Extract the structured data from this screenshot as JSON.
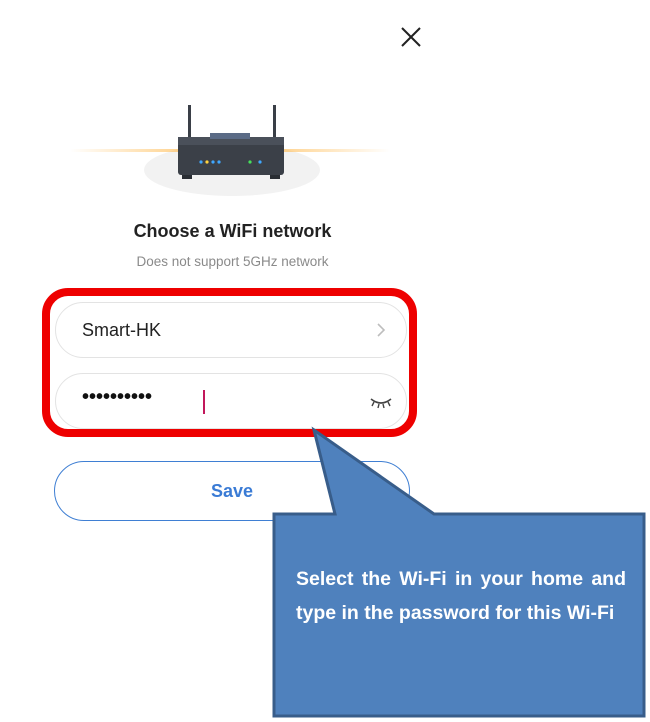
{
  "window": {
    "close_icon": "close-icon"
  },
  "hero": {
    "image": "wifi-router-illustration"
  },
  "header": {
    "title": "Choose a WiFi network",
    "subtitle": "Does not support 5GHz network"
  },
  "form": {
    "ssid_value": "Smart-HK",
    "ssid_icon": "chevron-right-icon",
    "password_masked": "••••••••••",
    "password_icon": "eye-closed-icon"
  },
  "actions": {
    "save_label": "Save"
  },
  "callout": {
    "text": "Select the Wi-Fi in your home and type in the password for this Wi-Fi",
    "fill": "#4f81bd",
    "border": "#385d8a"
  },
  "colors": {
    "accent": "#3a7bd5",
    "highlight": "#ee0000",
    "caret": "#c2185b"
  }
}
